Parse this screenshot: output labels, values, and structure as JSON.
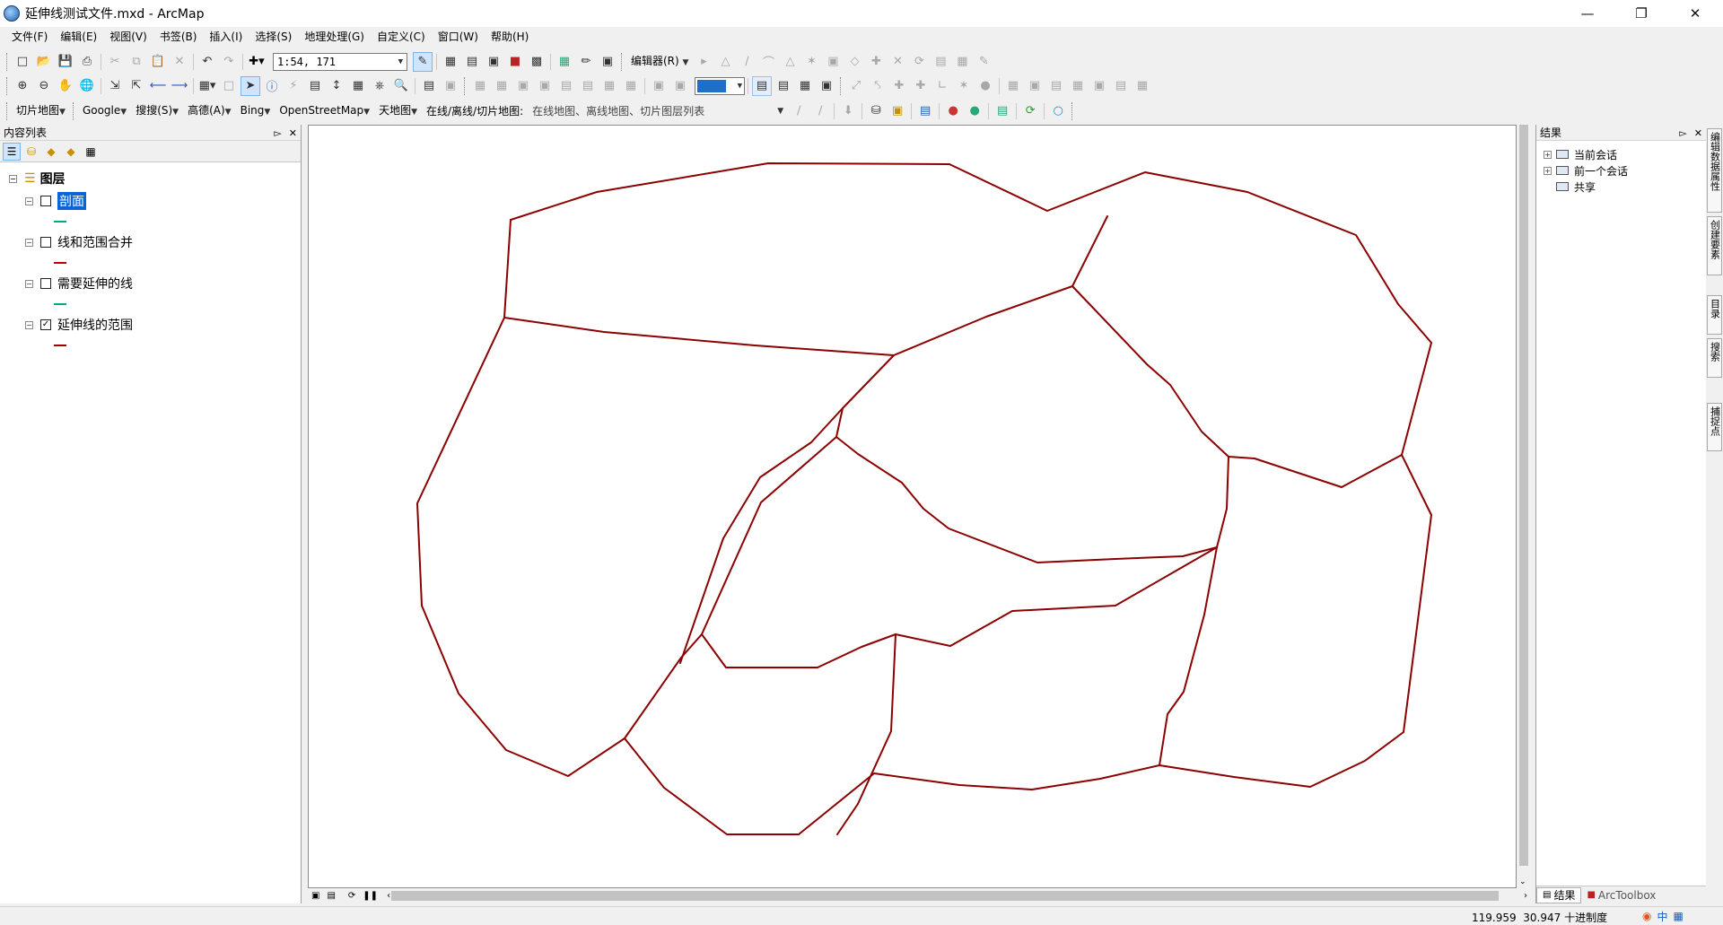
{
  "window": {
    "title": "延伸线测试文件.mxd - ArcMap"
  },
  "menubar": [
    "文件(F)",
    "编辑(E)",
    "视图(V)",
    "书签(B)",
    "插入(I)",
    "选择(S)",
    "地理处理(G)",
    "自定义(C)",
    "窗口(W)",
    "帮助(H)"
  ],
  "toolbar1": {
    "scale": "1:54, 171",
    "editor": "编辑器(R)"
  },
  "toolbar3": {
    "items": [
      "切片地图",
      "Google",
      "搜搜(S)",
      "高德(A)",
      "Bing",
      "OpenStreetMap",
      "天地图"
    ],
    "online_label": "在线/离线/切片地图:",
    "online_value": "在线地图、离线地图、切片图层列表"
  },
  "toc": {
    "title": "内容列表",
    "root": "图层",
    "layers": [
      {
        "name": "剖面",
        "checked": false,
        "selected": true,
        "color": "#00a884"
      },
      {
        "name": "线和范围合并",
        "checked": false,
        "selected": false,
        "color": "#c00000"
      },
      {
        "name": "需要延伸的线",
        "checked": false,
        "selected": false,
        "color": "#00a884"
      },
      {
        "name": "延伸线的范围",
        "checked": true,
        "selected": false,
        "color": "#a00000"
      }
    ]
  },
  "map": {
    "line_color": "#8b0000"
  },
  "results": {
    "title": "结果",
    "items": [
      "当前会话",
      "前一个会话",
      "共享"
    ],
    "tabs": [
      "结果",
      "ArcToolbox"
    ]
  },
  "right_tabs": [
    "编辑数据属性",
    "创建要素",
    "目录",
    "搜索",
    "捕捉点"
  ],
  "status": {
    "x": "119.959",
    "y": "30.947",
    "units": "十进制度"
  },
  "ime": {
    "mode": "中"
  }
}
